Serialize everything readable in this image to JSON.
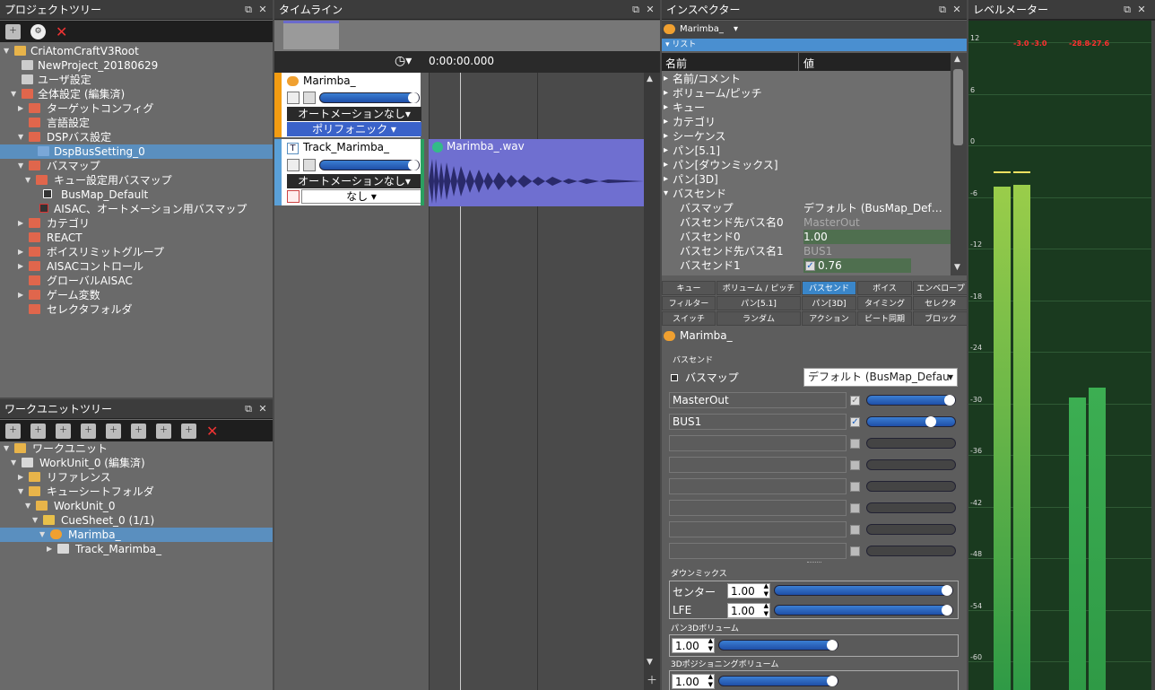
{
  "project_tree": {
    "title": "プロジェクトツリー",
    "items": [
      {
        "label": "CriAtomCraftV3Root"
      },
      {
        "label": "NewProject_20180629"
      },
      {
        "label": "ユーザ設定"
      },
      {
        "label": "全体設定 (編集済)"
      },
      {
        "label": "ターゲットコンフィグ"
      },
      {
        "label": "言語設定"
      },
      {
        "label": "DSPバス設定"
      },
      {
        "label": "DspBusSetting_0"
      },
      {
        "label": "バスマップ"
      },
      {
        "label": "キュー設定用バスマップ"
      },
      {
        "label": "BusMap_Default"
      },
      {
        "label": "AISAC、オートメーション用バスマップ"
      },
      {
        "label": "カテゴリ"
      },
      {
        "label": "REACT"
      },
      {
        "label": "ボイスリミットグループ"
      },
      {
        "label": "AISACコントロール"
      },
      {
        "label": "グローバルAISAC"
      },
      {
        "label": "ゲーム変数"
      },
      {
        "label": "セレクタフォルダ"
      }
    ]
  },
  "workunit_tree": {
    "title": "ワークユニットツリー",
    "items": [
      {
        "label": "ワークユニット"
      },
      {
        "label": "WorkUnit_0 (編集済)"
      },
      {
        "label": "リファレンス"
      },
      {
        "label": "キューシートフォルダ"
      },
      {
        "label": "WorkUnit_0"
      },
      {
        "label": "CueSheet_0 (1/1)"
      },
      {
        "label": "Marimba_"
      },
      {
        "label": "Track_Marimba_"
      }
    ]
  },
  "timeline": {
    "title": "タイムライン",
    "time": "0:00:00.000",
    "cue_name": "Marimba_",
    "automation_label": "オートメーションなし",
    "polyphonic_label": "ポリフォニック",
    "track_name": "Track_Marimba_",
    "track_automation": "オートメーションなし",
    "track_none": "なし",
    "waveform_name": "Marimba_.wav"
  },
  "inspector": {
    "title": "インスペクター",
    "header_name": "Marimba_",
    "list_label": "リスト",
    "col_name": "名前",
    "col_value": "値",
    "props": [
      {
        "name": "名前/コメント",
        "value": ""
      },
      {
        "name": "ボリューム/ピッチ",
        "value": ""
      },
      {
        "name": "キュー",
        "value": ""
      },
      {
        "name": "カテゴリ",
        "value": ""
      },
      {
        "name": "シーケンス",
        "value": ""
      },
      {
        "name": "パン[5.1]",
        "value": ""
      },
      {
        "name": "パン[ダウンミックス]",
        "value": ""
      },
      {
        "name": "パン[3D]",
        "value": ""
      },
      {
        "name": "バスセンド",
        "value": ""
      },
      {
        "name": "バスマップ",
        "value": "デフォルト (BusMap_Def…"
      },
      {
        "name": "バスセンド先バス名0",
        "value": "MasterOut"
      },
      {
        "name": "バスセンド0",
        "value": "1.00"
      },
      {
        "name": "バスセンド先バス名1",
        "value": "BUS1"
      },
      {
        "name": "バスセンド1",
        "value": "0.76"
      }
    ],
    "tabs_row1": [
      "キュー",
      "ボリューム / ピッチ",
      "バスセンド",
      "ボイス",
      "エンベロープ"
    ],
    "tabs_row2": [
      "フィルター",
      "パン[5.1]",
      "パン[3D]",
      "タイミング",
      "セレクタ"
    ],
    "tabs_row3": [
      "スイッチ",
      "ランダム",
      "アクション",
      "ビート同期",
      "ブロック"
    ],
    "detail_name": "Marimba_",
    "bussend_section": "バスセンド",
    "busmap_label": "バスマップ",
    "busmap_value": "デフォルト (BusMap_Defau",
    "bus_rows": [
      {
        "name": "MasterOut",
        "level": 1.0
      },
      {
        "name": "BUS1",
        "level": 0.76
      }
    ],
    "downmix_section": "ダウンミックス",
    "center_label": "センター",
    "center_value": "1.00",
    "lfe_label": "LFE",
    "lfe_value": "1.00",
    "pan3d_section": "パン3Dボリューム",
    "pan3d_value": "1.00",
    "pos3d_section": "3Dポジショニングボリューム",
    "pos3d_value": "1.00"
  },
  "level_meter": {
    "title": "レベルメーター",
    "peaks": [
      "-3.0",
      "-3.0",
      "-28.8",
      "-27.6"
    ],
    "scale": [
      "12",
      "6",
      "0",
      "-6",
      "-12",
      "-18",
      "-24",
      "-30",
      "-36",
      "-42",
      "-48",
      "-54",
      "-60"
    ]
  },
  "colors": {
    "selection": "#5a8fbf",
    "accent_blue": "#3a86c9",
    "meter_green": "#3cae52"
  }
}
